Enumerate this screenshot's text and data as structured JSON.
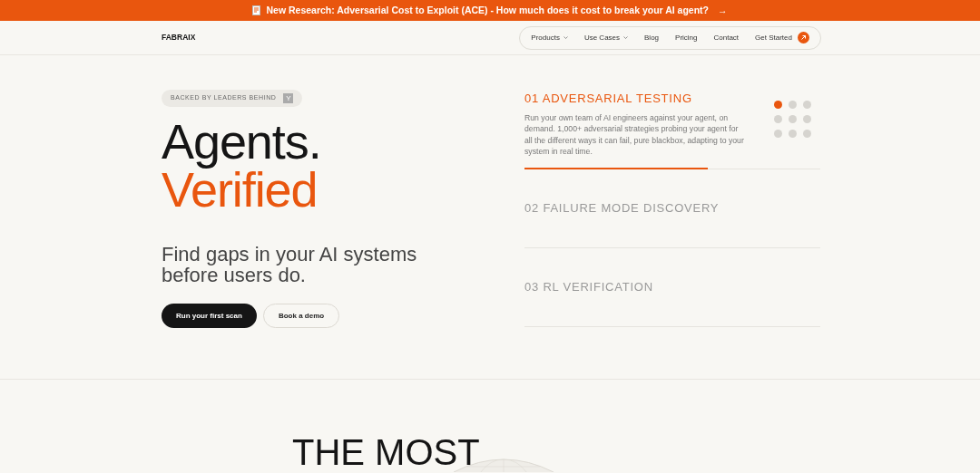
{
  "banner": {
    "text": "New Research: Adversarial Cost to Exploit (ACE) - How much does it cost to break your AI agent?",
    "arrow": "→"
  },
  "nav": {
    "logo": "FABRAIX",
    "items": [
      {
        "label": "Products",
        "dropdown": true
      },
      {
        "label": "Use Cases",
        "dropdown": true
      },
      {
        "label": "Blog",
        "dropdown": false
      },
      {
        "label": "Pricing",
        "dropdown": false
      },
      {
        "label": "Contact",
        "dropdown": false
      }
    ],
    "cta": "Get Started"
  },
  "hero": {
    "badge": "BACKED BY LEADERS BEHIND",
    "badge_logo": "Y",
    "title_1": "Agents.",
    "title_2": "Verified",
    "subtitle": "Find gaps in your AI systems before users do.",
    "buttons": [
      {
        "label": "Run your first scan",
        "kind": "primary"
      },
      {
        "label": "Book a demo",
        "kind": "secondary"
      }
    ]
  },
  "features": [
    {
      "title": "01 ADVERSARIAL TESTING",
      "selected": true,
      "text": "Run your own team of AI engineers against your agent, on demand. 1,000+ adversarial strategies probing your agent for all the different ways it can fail, pure blackbox, adapting to your system in real time.",
      "level": 0.62
    },
    {
      "title": "02 FAILURE MODE DISCOVERY",
      "selected": false
    },
    {
      "title": "03 RL VERIFICATION",
      "selected": false
    }
  ],
  "dots": [
    {
      "selected": true
    },
    {
      "selected": false
    },
    {
      "selected": false
    },
    {
      "selected": false
    },
    {
      "selected": false
    },
    {
      "selected": false
    },
    {
      "selected": false
    },
    {
      "selected": false
    },
    {
      "selected": false
    }
  ],
  "next_section": {
    "heading": "THE MOST"
  }
}
